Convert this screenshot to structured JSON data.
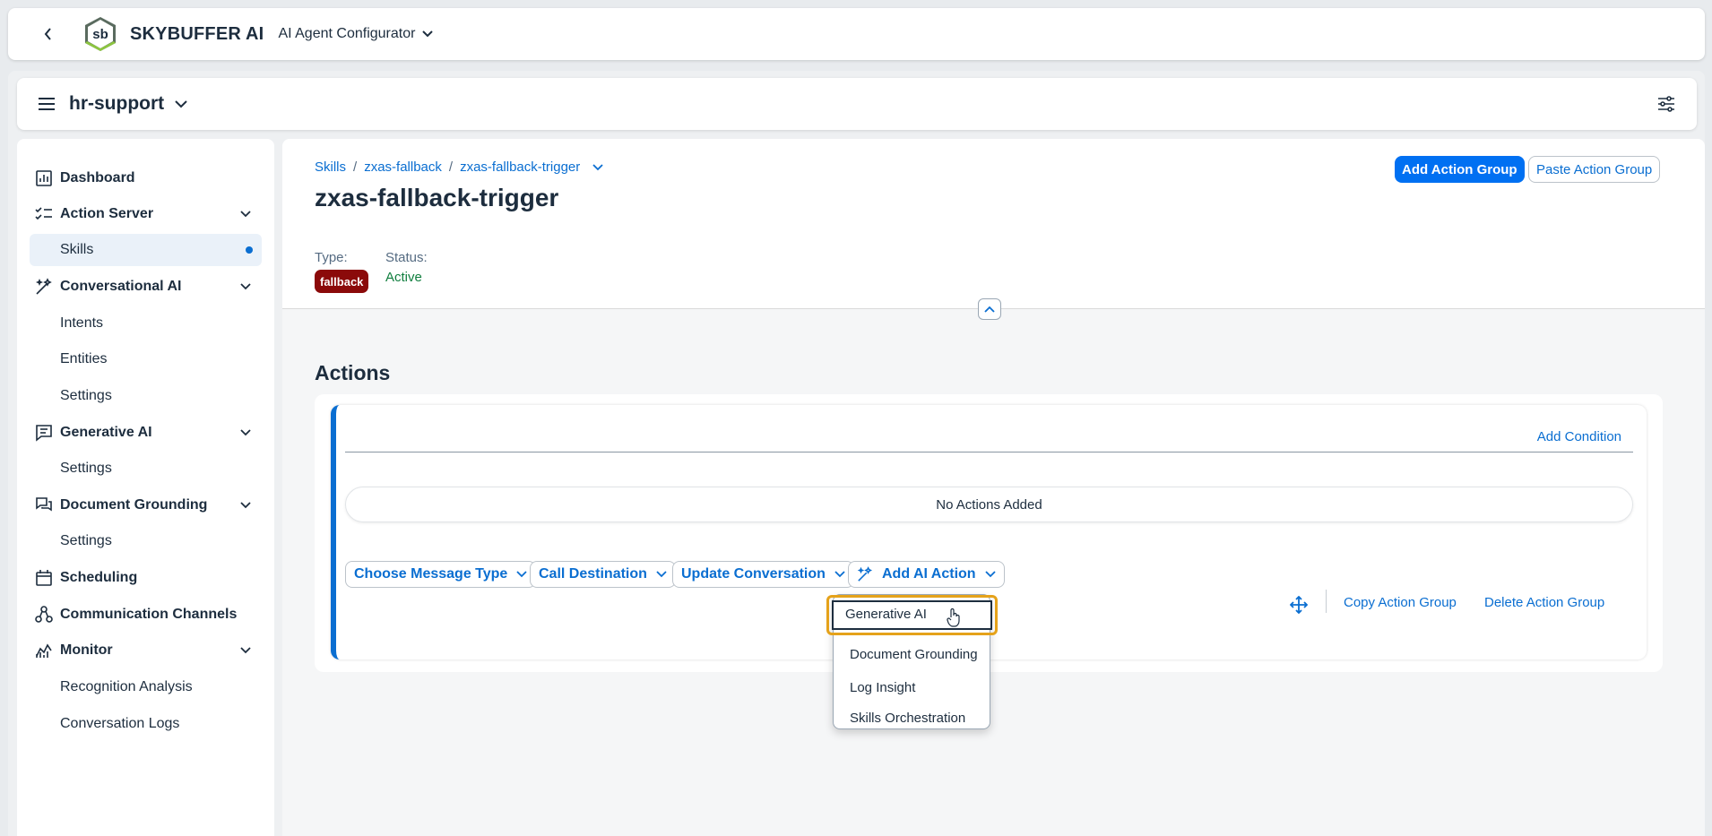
{
  "shell": {
    "brand": "SKYBUFFER AI",
    "logo_text": "sb",
    "product": "AI Agent Configurator"
  },
  "project": {
    "name": "hr-support"
  },
  "sidebar": {
    "items": [
      {
        "label": "Dashboard"
      },
      {
        "label": "Action Server"
      },
      {
        "label": "Skills"
      },
      {
        "label": "Conversational AI"
      },
      {
        "label": "Intents"
      },
      {
        "label": "Entities"
      },
      {
        "label": "Settings"
      },
      {
        "label": "Generative AI"
      },
      {
        "label": "Settings"
      },
      {
        "label": "Document Grounding"
      },
      {
        "label": "Settings"
      },
      {
        "label": "Scheduling"
      },
      {
        "label": "Communication Channels"
      },
      {
        "label": "Monitor"
      },
      {
        "label": "Recognition Analysis"
      },
      {
        "label": "Conversation Logs"
      }
    ]
  },
  "page": {
    "breadcrumb": [
      "Skills",
      "zxas-fallback",
      "zxas-fallback-trigger"
    ],
    "breadcrumb_sep": "/",
    "title": "zxas-fallback-trigger",
    "add_action_group": "Add Action Group",
    "paste_action_group": "Paste Action Group",
    "type_label": "Type:",
    "type_value": "fallback",
    "status_label": "Status:",
    "status_value": "Active",
    "actions_title": "Actions"
  },
  "action_group": {
    "add_condition": "Add Condition",
    "empty_text": "No Actions Added",
    "buttons": [
      "Choose Message Type",
      "Call Destination",
      "Update Conversation",
      "Add AI Action"
    ],
    "copy": "Copy Action Group",
    "delete": "Delete Action Group"
  },
  "menu": {
    "items": [
      "Generative AI",
      "Document Grounding",
      "Log Insight",
      "Skills Orchestration"
    ],
    "focused": "Generative AI"
  },
  "colors": {
    "accent": "#0a6ed1",
    "primary_button": "#0070f2",
    "badge": "#8b0a0a",
    "status": "#107e3e",
    "focus": "#e5a21a"
  }
}
